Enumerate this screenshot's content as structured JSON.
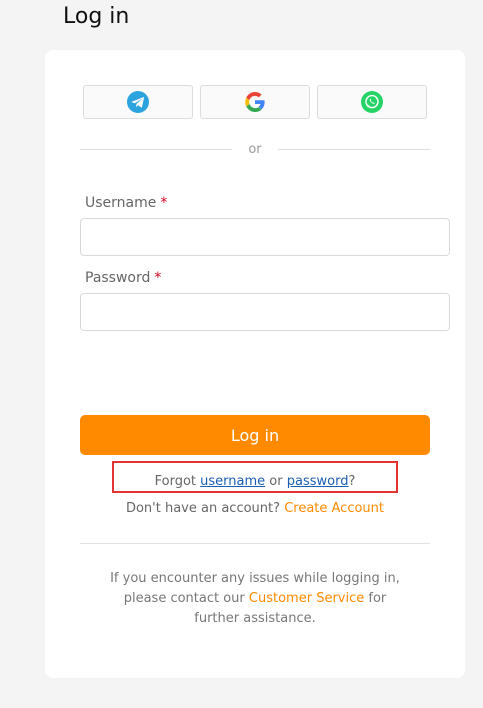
{
  "page": {
    "title": "Log in"
  },
  "social": {
    "buttons": [
      {
        "name": "telegram",
        "icon": "telegram-icon",
        "color": "#2aa3df"
      },
      {
        "name": "google",
        "icon": "google-icon"
      },
      {
        "name": "whatsapp",
        "icon": "whatsapp-icon",
        "color": "#25d366"
      }
    ],
    "divider_text": "or"
  },
  "form": {
    "username_label": "Username",
    "password_label": "Password",
    "required_mark": "*",
    "username_value": "",
    "password_value": "",
    "submit_label": "Log in"
  },
  "recovery": {
    "prefix": "Forgot",
    "username_link": "username",
    "middle": "or",
    "password_link": "password",
    "suffix": "?"
  },
  "signup": {
    "text": "Don't have an account?",
    "link": "Create Account"
  },
  "help": {
    "text_before": "If you encounter any issues while logging in, please contact our",
    "link": "Customer Service",
    "text_after": "for further assistance."
  },
  "colors": {
    "accent": "#ff8a00",
    "link": "#1a5fb4",
    "required": "#d0021b",
    "highlight": "#e3342f"
  }
}
